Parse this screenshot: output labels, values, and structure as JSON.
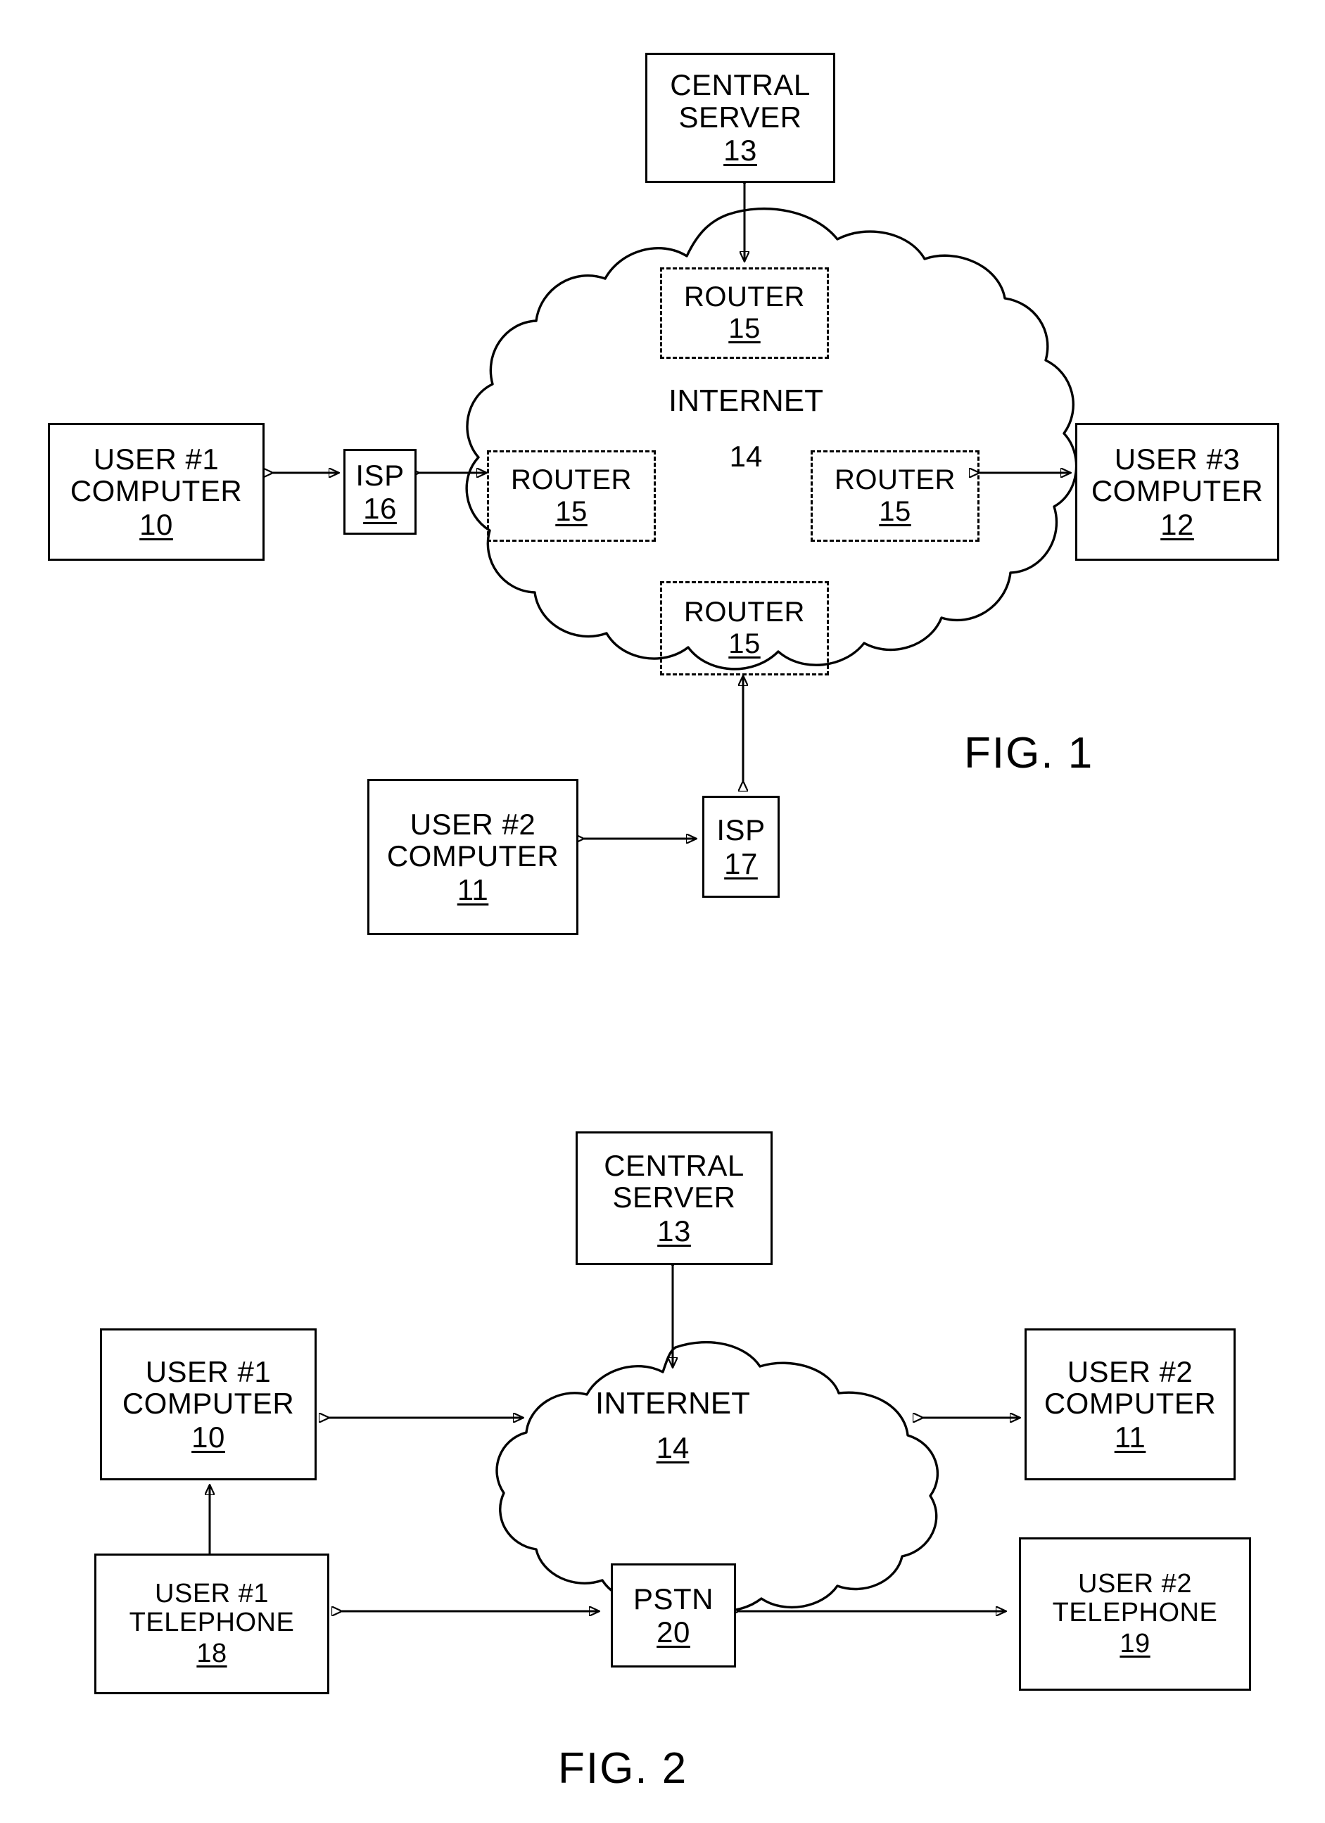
{
  "document": {
    "type": "patent-drawing-sheet",
    "figures": [
      "FIG. 1",
      "FIG. 2"
    ]
  },
  "fig1": {
    "label": "FIG. 1",
    "cloud": {
      "name": "internet-cloud",
      "title": "INTERNET",
      "reference": "14"
    },
    "nodes": [
      {
        "id": "central-server-13",
        "line1": "CENTRAL",
        "line2": "SERVER",
        "reference": "13",
        "style": "solid"
      },
      {
        "id": "router-top-15",
        "line1": "ROUTER",
        "line2": "",
        "reference": "15",
        "style": "dashed"
      },
      {
        "id": "router-left-15",
        "line1": "ROUTER",
        "line2": "",
        "reference": "15",
        "style": "dashed"
      },
      {
        "id": "router-right-15",
        "line1": "ROUTER",
        "line2": "",
        "reference": "15",
        "style": "dashed"
      },
      {
        "id": "router-bottom-15",
        "line1": "ROUTER",
        "line2": "",
        "reference": "15",
        "style": "dashed"
      },
      {
        "id": "user1-computer-10",
        "line1": "USER #1",
        "line2": "COMPUTER",
        "reference": "10",
        "style": "solid"
      },
      {
        "id": "isp-16",
        "line1": "ISP",
        "line2": "",
        "reference": "16",
        "style": "solid"
      },
      {
        "id": "user3-computer-12",
        "line1": "USER #3",
        "line2": "COMPUTER",
        "reference": "12",
        "style": "solid"
      },
      {
        "id": "user2-computer-11",
        "line1": "USER #2",
        "line2": "COMPUTER",
        "reference": "11",
        "style": "solid"
      },
      {
        "id": "isp-17",
        "line1": "ISP",
        "line2": "",
        "reference": "17",
        "style": "solid"
      }
    ],
    "connections": [
      {
        "from": "central-server-13",
        "to": "router-top-15",
        "arrows": "both"
      },
      {
        "from": "user1-computer-10",
        "to": "isp-16",
        "arrows": "both"
      },
      {
        "from": "isp-16",
        "to": "router-left-15",
        "arrows": "both"
      },
      {
        "from": "router-right-15",
        "to": "user3-computer-12",
        "arrows": "both"
      },
      {
        "from": "user2-computer-11",
        "to": "isp-17",
        "arrows": "both"
      },
      {
        "from": "isp-17",
        "to": "router-bottom-15",
        "arrows": "both"
      }
    ]
  },
  "fig2": {
    "label": "FIG. 2",
    "cloud": {
      "name": "internet-cloud",
      "title": "INTERNET",
      "reference": "14"
    },
    "nodes": [
      {
        "id": "central-server-13",
        "line1": "CENTRAL",
        "line2": "SERVER",
        "reference": "13",
        "style": "solid"
      },
      {
        "id": "user1-computer-10",
        "line1": "USER #1",
        "line2": "COMPUTER",
        "reference": "10",
        "style": "solid"
      },
      {
        "id": "user2-computer-11",
        "line1": "USER #2",
        "line2": "COMPUTER",
        "reference": "11",
        "style": "solid"
      },
      {
        "id": "user1-telephone-18",
        "line1": "USER #1",
        "line2": "TELEPHONE",
        "reference": "18",
        "style": "solid"
      },
      {
        "id": "pstn-20",
        "line1": "PSTN",
        "line2": "",
        "reference": "20",
        "style": "solid"
      },
      {
        "id": "user2-telephone-19",
        "line1": "USER #2",
        "line2": "TELEPHONE",
        "reference": "19",
        "style": "solid"
      }
    ],
    "connections": [
      {
        "from": "central-server-13",
        "to": "internet-cloud",
        "arrows": "both"
      },
      {
        "from": "user1-computer-10",
        "to": "internet-cloud",
        "arrows": "both"
      },
      {
        "from": "internet-cloud",
        "to": "user2-computer-11",
        "arrows": "both"
      },
      {
        "from": "user1-telephone-18",
        "to": "user1-computer-10",
        "arrows": "single-up"
      },
      {
        "from": "user1-telephone-18",
        "to": "pstn-20",
        "arrows": "both"
      },
      {
        "from": "pstn-20",
        "to": "user2-telephone-19",
        "arrows": "both"
      }
    ]
  }
}
